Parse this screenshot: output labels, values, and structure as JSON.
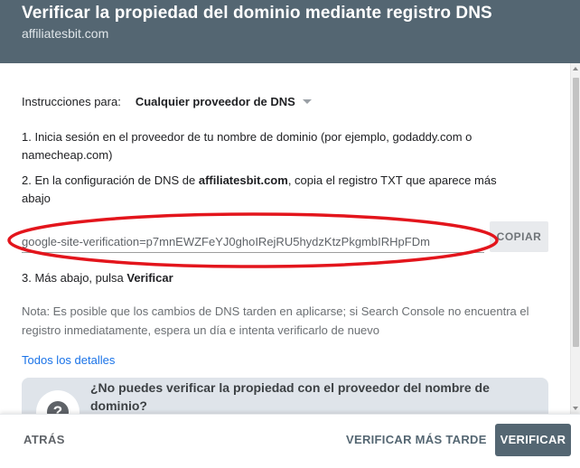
{
  "header": {
    "title": "Verificar la propiedad del dominio mediante registro DNS",
    "domain": "affiliatesbit.com"
  },
  "instructions": {
    "label": "Instrucciones para:",
    "provider": "Cualquier proveedor de DNS"
  },
  "steps": {
    "step1": "1. Inicia sesión en el proveedor de tu nombre de dominio (por ejemplo, godaddy.com o namecheap.com)",
    "step2_prefix": "2. En la configuración de DNS de ",
    "step2_domain": "affiliatesbit.com",
    "step2_suffix": ", copia el registro TXT que aparece más abajo",
    "step3_prefix": "3. Más abajo, pulsa ",
    "step3_bold": "Verificar"
  },
  "txt_record": "google-site-verification=p7mnEWZFeYJ0ghoIRejRU5hydzKtzPkgmbIRHpFDm",
  "copy_label": "COPIAR",
  "annotation_color": "#e3151c",
  "note": "Nota: Es posible que los cambios de DNS tarden en aplicarse; si Search Console no encuentra el registro inmediatamente, espera un día e intenta verificarlo de nuevo",
  "details_link": "Todos los detalles",
  "help": {
    "title": "¿No puedes verificar la propiedad con el proveedor del nombre de dominio?",
    "icon_glyph": "?"
  },
  "footer": {
    "back": "ATRÁS",
    "later": "VERIFICAR MÁS TARDE",
    "verify": "VERIFICAR"
  }
}
